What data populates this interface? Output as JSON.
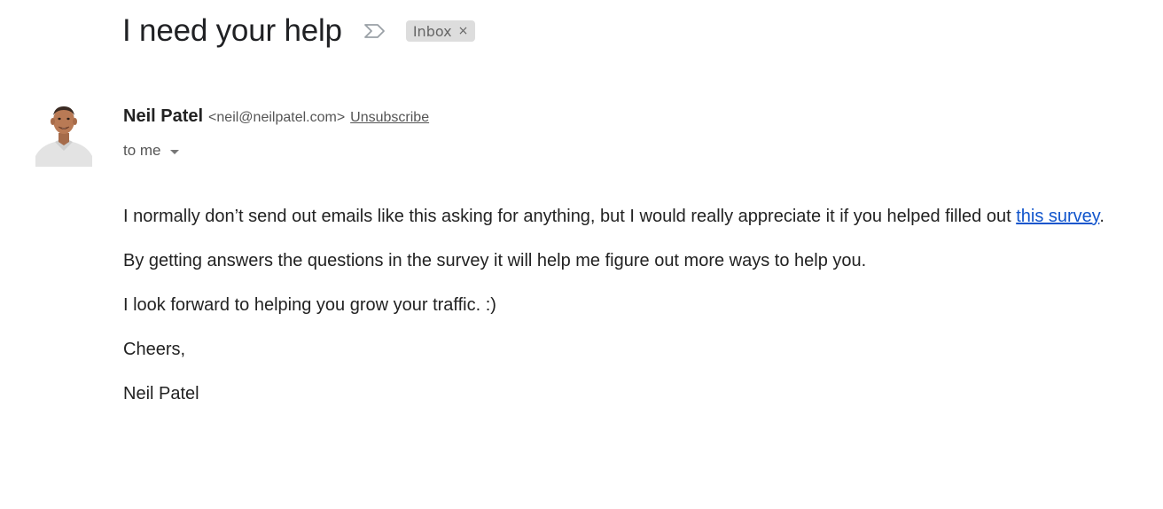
{
  "email": {
    "subject": "I need your help",
    "important_marker_icon": "importance-marker-icon",
    "label": {
      "text": "Inbox",
      "close_symbol": "×",
      "color": "#dddddd"
    },
    "sender": {
      "avatar_icon": "avatar",
      "name": "Neil Patel",
      "email": "<neil@neilpatel.com>",
      "unsubscribe": "Unsubscribe"
    },
    "recipient": {
      "text": "to me",
      "icon": "chevron-down-icon"
    },
    "body": {
      "paragraph1_before": "I normally don’t send out emails like this asking for anything, but I would really appreciate it if you helped filled out ",
      "paragraph1_link": "this survey",
      "paragraph1_after": ".",
      "paragraph2": "By getting answers the questions in the survey it will help me figure out more ways to help you.",
      "paragraph3": "I look forward to helping you grow your traffic. :)",
      "closing": "Cheers,",
      "signature": "Neil Patel"
    },
    "link_color": "#1155cc"
  }
}
